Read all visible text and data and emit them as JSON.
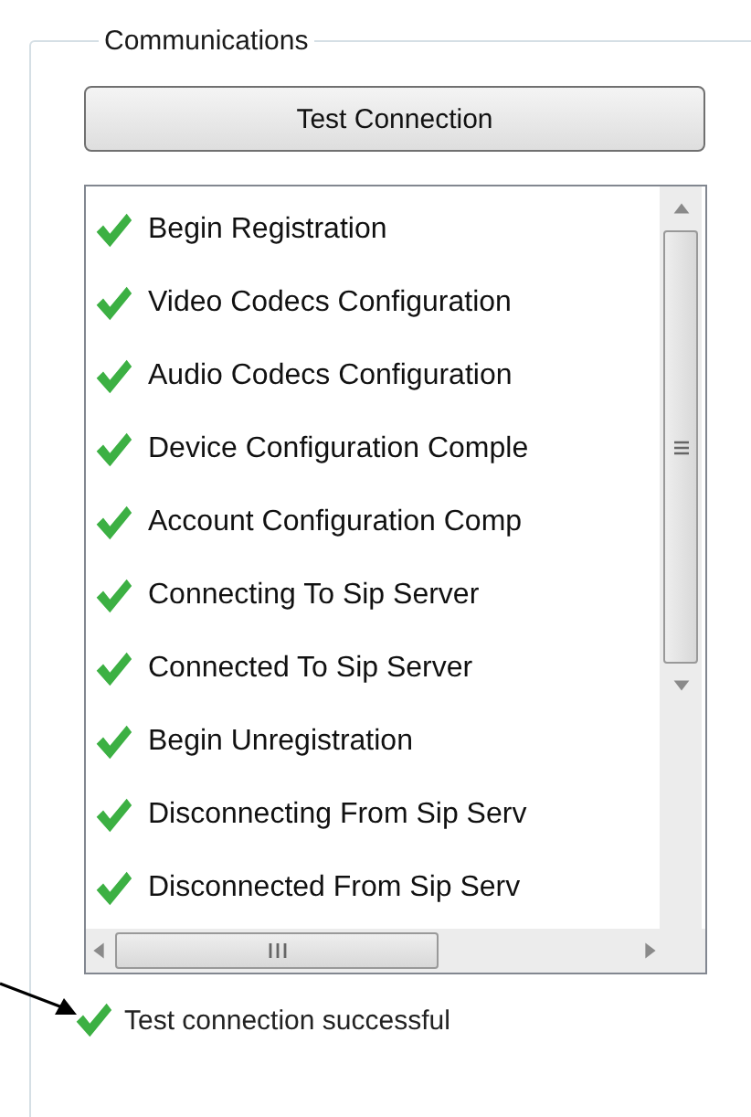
{
  "group": {
    "title": "Communications"
  },
  "test_button": {
    "label": "Test Connection"
  },
  "log": {
    "items": [
      {
        "text": "Begin Registration"
      },
      {
        "text": "Video Codecs Configuration"
      },
      {
        "text": "Audio Codecs Configuration"
      },
      {
        "text": "Device Configuration Comple"
      },
      {
        "text": "Account Configuration Comp"
      },
      {
        "text": "Connecting To Sip Server"
      },
      {
        "text": "Connected To Sip Server"
      },
      {
        "text": "Begin Unregistration"
      },
      {
        "text": "Disconnecting From Sip Serv"
      },
      {
        "text": "Disconnected From Sip Serv"
      }
    ]
  },
  "status": {
    "text": "Test connection successful"
  }
}
